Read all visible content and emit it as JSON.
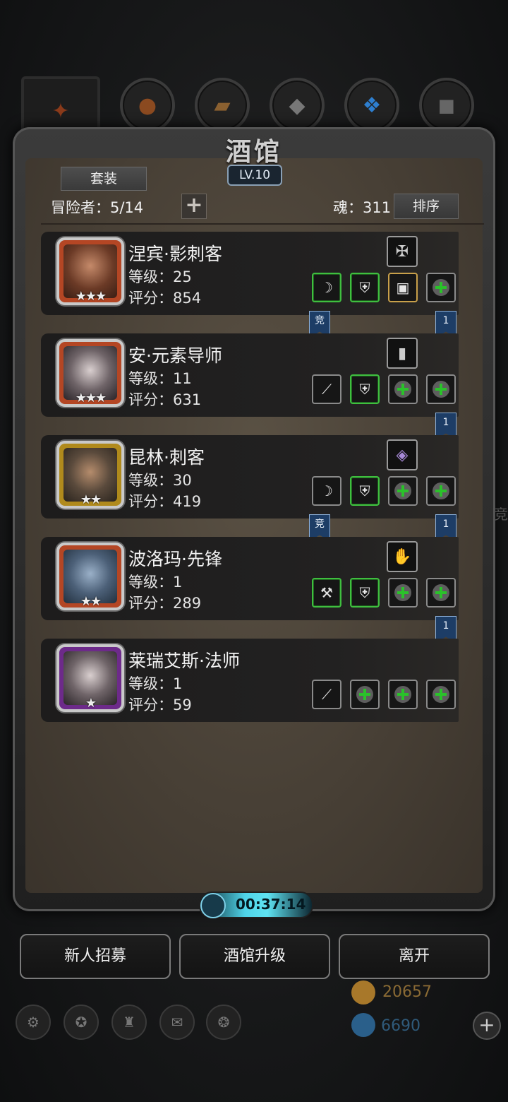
{
  "title": "酒馆",
  "level_badge": "LV.10",
  "suit_button": "套装",
  "adventurers_label": "冒险者：5/14",
  "soul_label": "魂：311",
  "sort_button": "排序",
  "side_label": "竞",
  "heroes": [
    {
      "name": "涅宾·影刺客",
      "level": "等级：25",
      "score": "评分：854",
      "stars": "★★★",
      "frame_color": "#b44624",
      "ribbon_left": "竞",
      "ribbon_right": "1"
    },
    {
      "name": "安·元素导师",
      "level": "等级：11",
      "score": "评分：631",
      "stars": "★★★",
      "frame_color": "#b44624",
      "ribbon_left": "",
      "ribbon_right": "1"
    },
    {
      "name": "昆林·刺客",
      "level": "等级：30",
      "score": "评分：419",
      "stars": "★★",
      "frame_color": "#b08a1c",
      "ribbon_left": "竞",
      "ribbon_right": "1"
    },
    {
      "name": "波洛玛·先锋",
      "level": "等级：1",
      "score": "评分：289",
      "stars": "★★",
      "frame_color": "#b44624",
      "ribbon_left": "",
      "ribbon_right": "1"
    },
    {
      "name": "莱瑞艾斯·法师",
      "level": "等级：1",
      "score": "评分：59",
      "stars": "★",
      "frame_color": "#6d2a8a",
      "ribbon_left": "",
      "ribbon_right": ""
    }
  ],
  "timer": "00:37:14",
  "bottom_buttons": [
    "新人招募",
    "酒馆升级",
    "离开"
  ],
  "gold": "20657",
  "gems": "6690"
}
